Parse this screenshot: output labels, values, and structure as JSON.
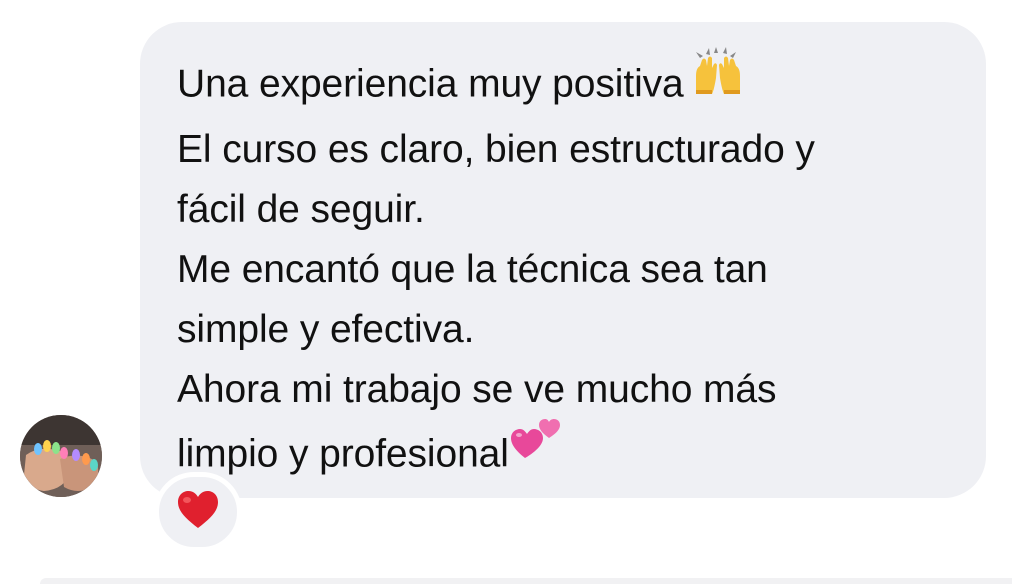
{
  "message": {
    "lines": [
      "Una experiencia muy positiva",
      "El curso es claro, bien estructurado y",
      "fácil de seguir.",
      "Me encantó que la técnica sea tan",
      "simple y efectiva.",
      "Ahora mi trabajo se ve mucho más",
      "limpio y profesional"
    ],
    "emojis": {
      "line_0": "raising-hands-icon",
      "line_6": "two-hearts-icon"
    }
  },
  "reaction": {
    "emoji": "red-heart-icon"
  },
  "avatar": {
    "icon": "avatar-painted-nails-photo"
  },
  "colors": {
    "bubble_bg": "#eff0f4",
    "text": "#111111",
    "heart_red": "#e0202e",
    "hearts_pink": "#e8489a"
  }
}
